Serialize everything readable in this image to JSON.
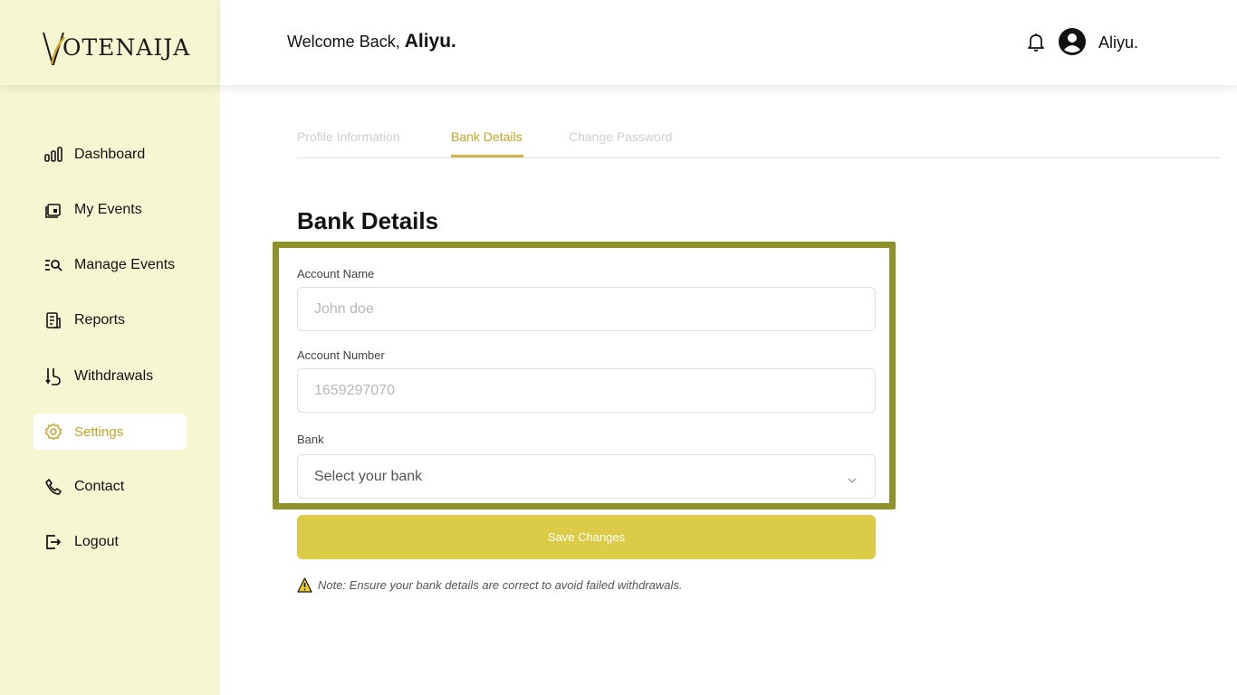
{
  "app": {
    "logo_first": "V",
    "logo_rest": "OTENAIJA"
  },
  "sidebar": {
    "items": [
      {
        "label": "Dashboard",
        "icon": "bar-chart-icon"
      },
      {
        "label": "My Events",
        "icon": "calendar-icon"
      },
      {
        "label": "Manage Events",
        "icon": "list-search-icon"
      },
      {
        "label": "Reports",
        "icon": "report-icon"
      },
      {
        "label": "Withdrawals",
        "icon": "withdraw-icon"
      },
      {
        "label": "Settings",
        "icon": "gear-icon",
        "active": true
      },
      {
        "label": "Contact",
        "icon": "phone-icon"
      },
      {
        "label": "Logout",
        "icon": "logout-icon"
      }
    ]
  },
  "header": {
    "welcome": "Welcome Back, ",
    "name": "Aliyu.",
    "user": "Aliyu."
  },
  "tabs": [
    "Profile Information",
    "Bank Details",
    "Change Password"
  ],
  "form": {
    "title": "Bank Details",
    "account_name_label": "Account Name",
    "account_name_placeholder": "John doe",
    "account_number_label": "Account Number",
    "account_number_placeholder": "1659297070",
    "bank_label": "Bank",
    "bank_value": "Select your bank",
    "save_label": "Save Changes",
    "note": "Note: Ensure your bank details are correct to avoid failed withdrawals."
  },
  "colors": {
    "accent": "#c9a227",
    "sidebar_bg": "#f6f7d2",
    "button": "#dccb47",
    "highlight": "#8f912a"
  }
}
